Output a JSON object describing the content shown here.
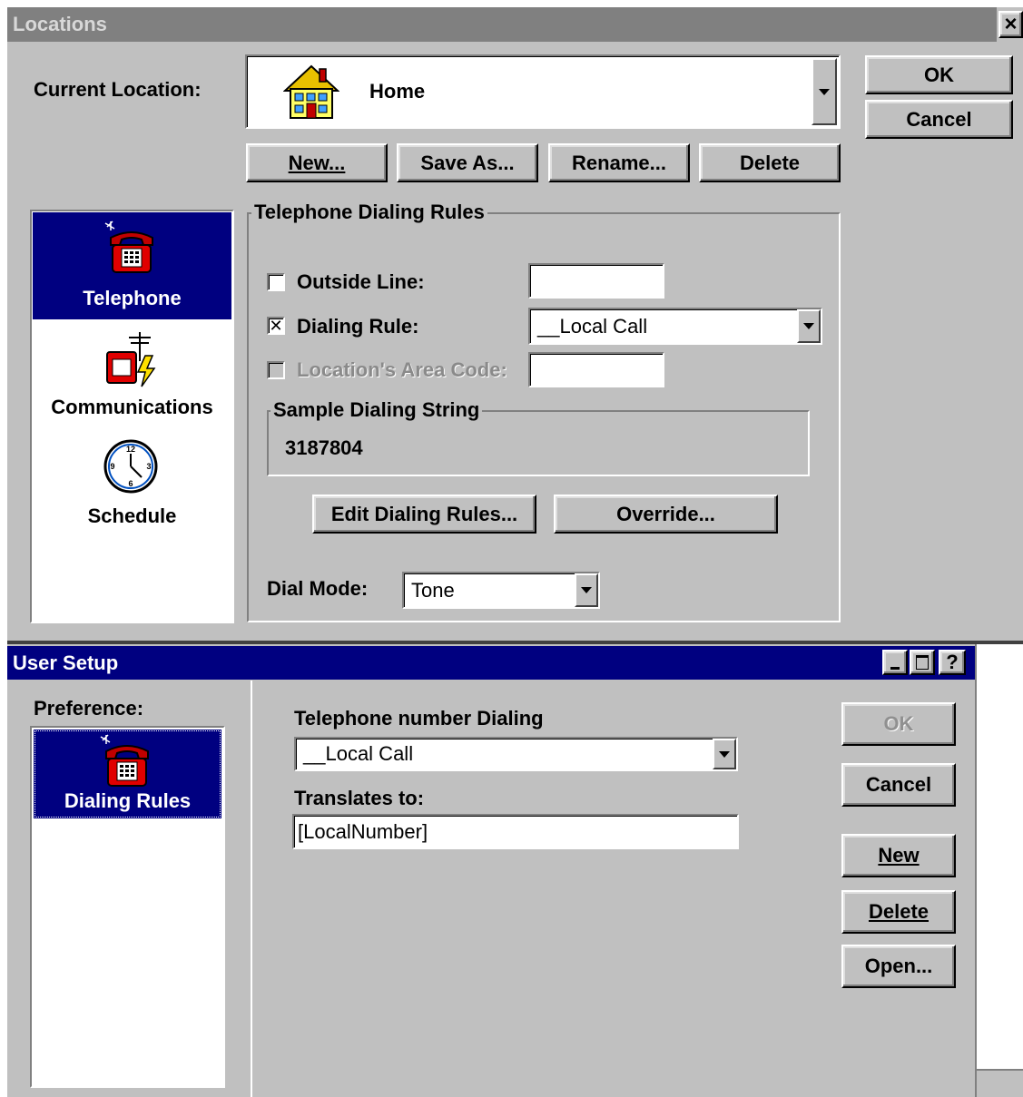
{
  "locations": {
    "title": "Locations",
    "close_glyph": "×",
    "current_location_label": "Current Location:",
    "current_location_value": "Home",
    "buttons": {
      "ok": "OK",
      "cancel": "Cancel",
      "new": "New...",
      "save_as": "Save As...",
      "rename": "Rename...",
      "delete": "Delete"
    },
    "sidebar": [
      {
        "label": "Telephone",
        "icon": "telephone-icon",
        "selected": true
      },
      {
        "label": "Communications",
        "icon": "communications-icon",
        "selected": false
      },
      {
        "label": "Schedule",
        "icon": "clock-icon",
        "selected": false
      }
    ],
    "dialing_rules": {
      "group_title": "Telephone Dialing Rules",
      "outside_line_label": "Outside Line:",
      "outside_line_checked": false,
      "outside_line_value": "",
      "dialing_rule_label": "Dialing Rule:",
      "dialing_rule_checked": true,
      "dialing_rule_value": "__Local Call",
      "area_code_label": "Location's Area Code:",
      "area_code_value": "",
      "sample_title": "Sample Dialing String",
      "sample_value": "3187804",
      "edit_button": "Edit Dialing Rules...",
      "override_button": "Override...",
      "dial_mode_label": "Dial Mode:",
      "dial_mode_value": "Tone"
    },
    "colors": {
      "titlebar_inactive": "#808080",
      "selection": "#000080",
      "face": "#c0c0c0"
    }
  },
  "user_setup": {
    "title": "User Setup",
    "preference_label": "Preference:",
    "preference_item": "Dialing Rules",
    "preference_icon": "telephone-icon",
    "tel_dialing_label": "Telephone number Dialing",
    "tel_dialing_value": "__Local Call",
    "translates_label": "Translates to:",
    "translates_value": "[LocalNumber]",
    "buttons": {
      "ok": "OK",
      "cancel": "Cancel",
      "new": "New",
      "delete": "Delete",
      "open": "Open..."
    },
    "titlebar_buttons": {
      "help": "?"
    }
  }
}
